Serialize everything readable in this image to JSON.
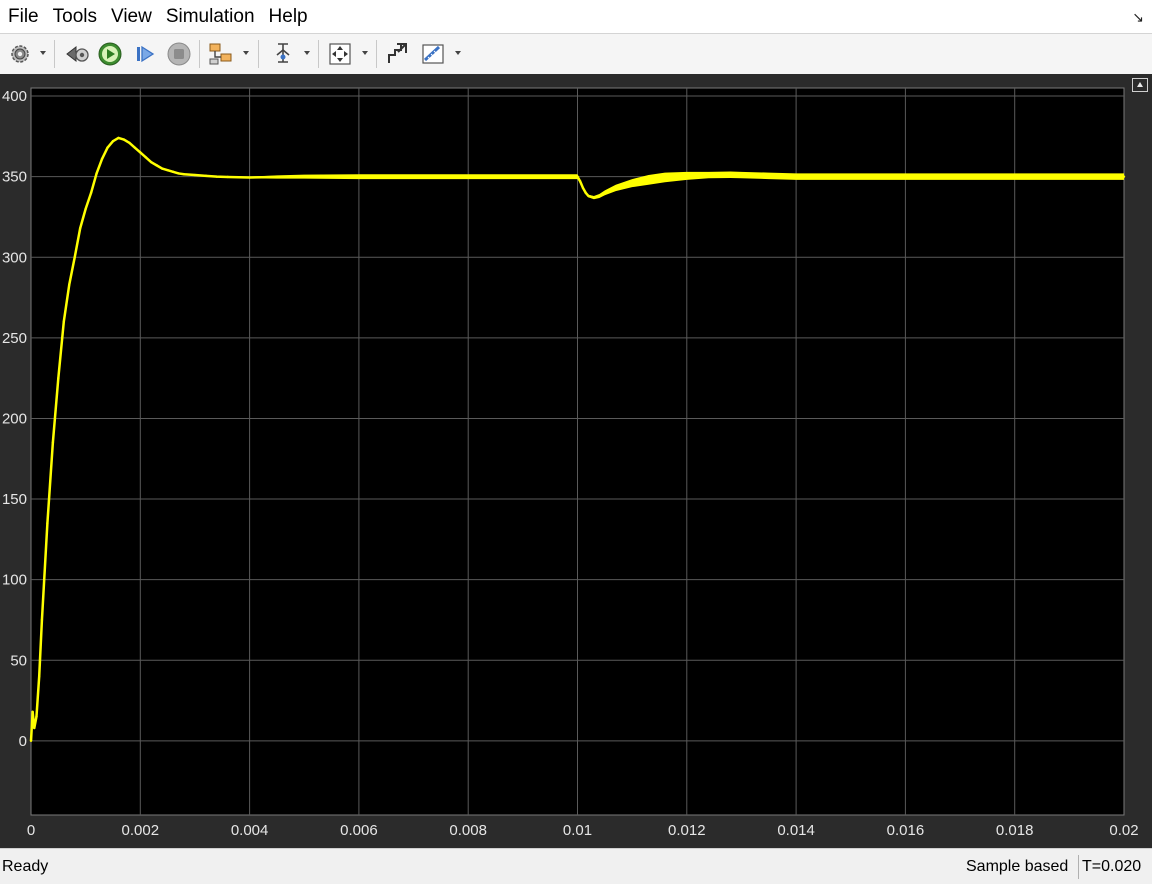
{
  "menu": [
    "File",
    "Tools",
    "View",
    "Simulation",
    "Help"
  ],
  "toolbar": {
    "icons": [
      "gear-icon",
      "step-back-icon",
      "run-icon",
      "step-forward-icon",
      "stop-icon",
      "highlight-block-icon",
      "triggers-icon",
      "autoscale-icon",
      "restore-icon",
      "measurements-icon"
    ]
  },
  "colors": {
    "trace": "#ffff00",
    "axes_bg": "#000000",
    "grid": "#5a5a5a",
    "frame_bg": "#2b2b2b"
  },
  "chart_data": {
    "type": "line",
    "title": "",
    "xlabel": "",
    "ylabel": "",
    "xlim": [
      0,
      0.02
    ],
    "ylim": [
      -46,
      405
    ],
    "grid": true,
    "x_ticks": [
      0,
      0.002,
      0.004,
      0.006,
      0.008,
      0.01,
      0.012,
      0.014,
      0.016,
      0.018,
      0.02
    ],
    "x_tick_labels": [
      "0",
      "0.002",
      "0.004",
      "0.006",
      "0.008",
      "0.01",
      "0.012",
      "0.014",
      "0.016",
      "0.018",
      "0.02"
    ],
    "y_ticks": [
      0,
      50,
      100,
      150,
      200,
      250,
      300,
      350,
      400
    ],
    "y_tick_labels": [
      "0",
      "50",
      "100",
      "150",
      "200",
      "250",
      "300",
      "350",
      "400"
    ],
    "series": [
      {
        "color": "#ffff00",
        "x": [
          0,
          3e-05,
          6e-05,
          0.0001,
          0.00015,
          0.0002,
          0.0003,
          0.0004,
          0.0005,
          0.0006,
          0.0007,
          0.0008,
          0.0009,
          0.001,
          0.0011,
          0.0012,
          0.0013,
          0.0014,
          0.0015,
          0.0016,
          0.0017,
          0.0018,
          0.0019,
          0.002,
          0.0021,
          0.0022,
          0.0023,
          0.0024,
          0.0025,
          0.0026,
          0.0027,
          0.0028,
          0.003,
          0.0032,
          0.0034,
          0.0036,
          0.0038,
          0.004,
          0.0045,
          0.005,
          0.006,
          0.007,
          0.008,
          0.009,
          0.01,
          0.01005,
          0.0101,
          0.01015,
          0.0102,
          0.0103,
          0.0104,
          0.0105,
          0.0107,
          0.011,
          0.0113,
          0.0116,
          0.012,
          0.0124,
          0.0128,
          0.013,
          0.0135,
          0.014,
          0.016,
          0.018,
          0.02
        ],
        "y": [
          0,
          18,
          8,
          15,
          40,
          75,
          135,
          185,
          225,
          260,
          283,
          300,
          318,
          330,
          340,
          352,
          361,
          368,
          372,
          374,
          373,
          371,
          368,
          365,
          362,
          359,
          357,
          355,
          354,
          353,
          352,
          351.5,
          351,
          350.5,
          350,
          349.8,
          349.6,
          349.5,
          349.8,
          350,
          350,
          350,
          350,
          350,
          350,
          347,
          343,
          340,
          338,
          337,
          338,
          340,
          343,
          346,
          348,
          349.5,
          350.5,
          351,
          351.2,
          351,
          350.5,
          350,
          350,
          350,
          350
        ],
        "ripple": [
          0,
          0,
          0,
          0,
          0,
          0,
          0,
          0,
          0,
          0,
          0,
          0,
          0,
          0,
          0,
          0,
          0,
          0,
          0,
          0,
          0,
          0,
          0,
          0,
          0,
          0,
          0,
          0,
          0,
          0,
          0,
          0,
          0,
          0,
          0,
          0,
          0.5,
          1,
          2,
          2.5,
          3,
          3,
          3,
          3,
          3,
          2,
          1.5,
          1.5,
          1.5,
          2,
          2.5,
          3,
          4,
          5,
          6,
          6,
          5,
          4,
          4,
          4,
          4,
          4,
          4,
          4,
          4
        ]
      }
    ]
  },
  "status": {
    "text": "Ready",
    "mode": "Sample based",
    "time": "T=0.020"
  }
}
